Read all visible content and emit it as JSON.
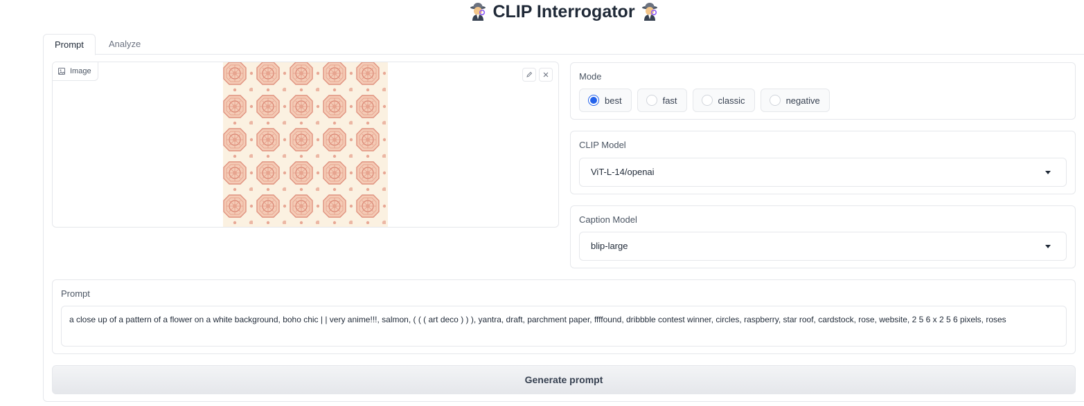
{
  "header": {
    "title": "CLIP Interrogator",
    "icon_left": "detective-emoji-icon",
    "icon_right": "detective-emoji-icon"
  },
  "tabs": [
    {
      "label": "Prompt",
      "active": true
    },
    {
      "label": "Analyze",
      "active": false
    }
  ],
  "image_panel": {
    "label": "Image",
    "actions": [
      "edit-icon",
      "close-icon"
    ],
    "pattern_colors": {
      "background": "#fbf1e1",
      "motif": "#e0917e"
    }
  },
  "mode": {
    "label": "Mode",
    "options": [
      "best",
      "fast",
      "classic",
      "negative"
    ],
    "selected": "best"
  },
  "clip_model": {
    "label": "CLIP Model",
    "value": "ViT-L-14/openai"
  },
  "caption_model": {
    "label": "Caption Model",
    "value": "blip-large"
  },
  "prompt": {
    "label": "Prompt",
    "text": "a close up of a pattern of a flower on a white background, boho chic | | very anime!!!, salmon, ( ( ( art deco ) ) ), yantra, draft, parchment paper, ffffound, dribbble contest winner, circles, raspberry, star roof, cardstock, rose, website, 2 5 6 x 2 5 6 pixels, roses"
  },
  "actions": {
    "generate_label": "Generate prompt"
  },
  "colors": {
    "accent": "#2563eb",
    "border": "#e5e7eb"
  }
}
